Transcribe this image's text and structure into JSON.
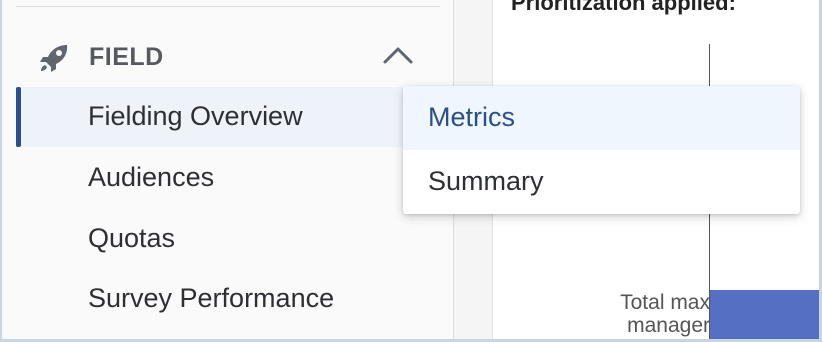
{
  "sidebar": {
    "section": {
      "title": "FIELD",
      "icon": "rocket-icon",
      "expanded": true
    },
    "items": [
      {
        "label": "Fielding Overview",
        "active": true
      },
      {
        "label": "Audiences",
        "active": false
      },
      {
        "label": "Quotas",
        "active": false
      },
      {
        "label": "Survey Performance",
        "active": false
      }
    ]
  },
  "dropdown": {
    "items": [
      {
        "label": "Metrics",
        "highlighted": true
      },
      {
        "label": "Summary",
        "highlighted": false
      }
    ]
  },
  "main": {
    "panel_title": "Prioritization applied:",
    "bar_label_line1": "Total max",
    "bar_label_line2": "manager"
  },
  "colors": {
    "accent": "#2b4f86",
    "bar": "#5570c2",
    "active_bg": "#eef3f9"
  }
}
